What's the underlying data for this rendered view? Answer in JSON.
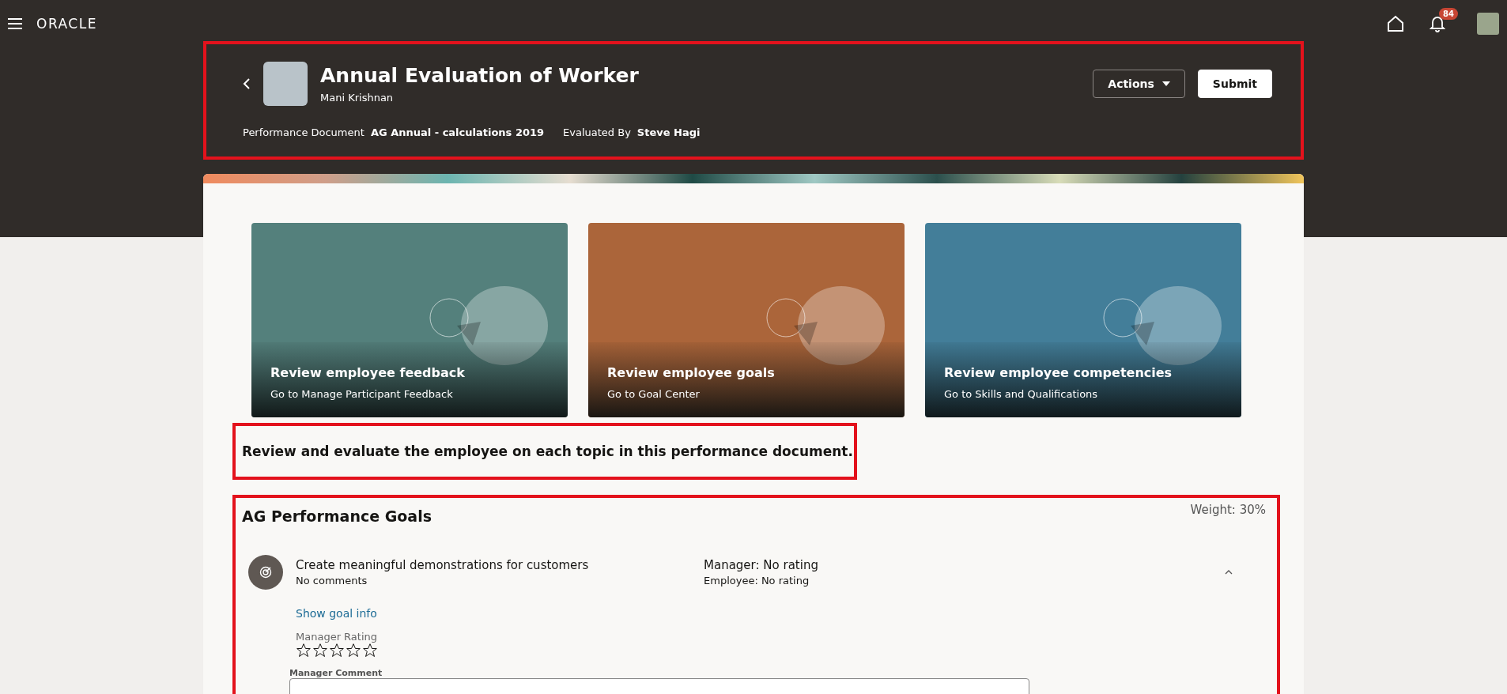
{
  "app_bar": {
    "brand": "ORACLE",
    "notification_count": "84"
  },
  "header": {
    "title": "Annual Evaluation of Worker",
    "person": "Mani Krishnan",
    "meta": [
      {
        "label": "Performance Document",
        "value": "AG Annual - calculations 2019"
      },
      {
        "label": "Evaluated By",
        "value": "Steve Hagi"
      }
    ],
    "actions_button": "Actions",
    "submit_button": "Submit"
  },
  "cards": [
    {
      "title": "Review employee feedback",
      "subtitle": "Go to Manage Participant Feedback",
      "color": "#54807c"
    },
    {
      "title": "Review employee goals",
      "subtitle": "Go to Goal Center",
      "color": "#ab653a"
    },
    {
      "title": "Review employee competencies",
      "subtitle": "Go to Skills and Qualifications",
      "color": "#437e99"
    }
  ],
  "instruction": "Review and evaluate the employee on each topic in this performance document.",
  "section": {
    "title": "AG Performance Goals",
    "weight": "Weight: 30%",
    "goals": [
      {
        "name": "Create meaningful demonstrations for customers",
        "comments": "No comments",
        "manager_rating": "Manager: No rating",
        "employee_rating": "Employee: No rating",
        "expanded": true,
        "link": "Show goal info",
        "rating_label": "Manager Rating",
        "stars": 0,
        "comment_label": "Manager Comment"
      }
    ]
  }
}
